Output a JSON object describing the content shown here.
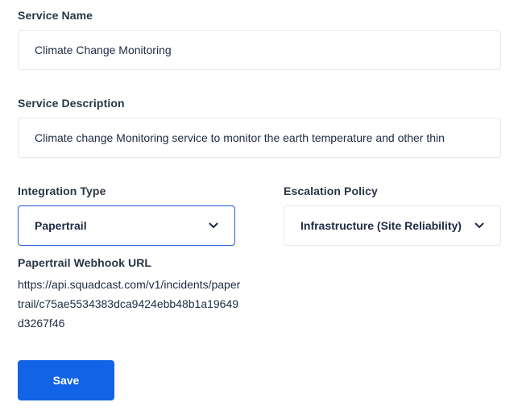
{
  "service_name": {
    "label": "Service Name",
    "value": "Climate Change Monitoring"
  },
  "service_description": {
    "label": "Service Description",
    "value": "Climate change Monitoring service to monitor the earth temperature and other thin"
  },
  "integration_type": {
    "label": "Integration Type",
    "selected": "Papertrail",
    "icon": "chevron-down-icon"
  },
  "escalation_policy": {
    "label": "Escalation Policy",
    "selected": "Infrastructure (Site Reliability)",
    "icon": "chevron-down-icon"
  },
  "webhook": {
    "label": "Papertrail Webhook URL",
    "url": "https://api.squadcast.com/v1/incidents/papertrail/c75ae5534383dca9424ebb48b1a19649d3267f46"
  },
  "actions": {
    "save_label": "Save"
  },
  "colors": {
    "primary": "#1363e6",
    "active_border": "#1f5fd8",
    "field_border": "#e6e8ee",
    "text": "#1f2a44"
  }
}
